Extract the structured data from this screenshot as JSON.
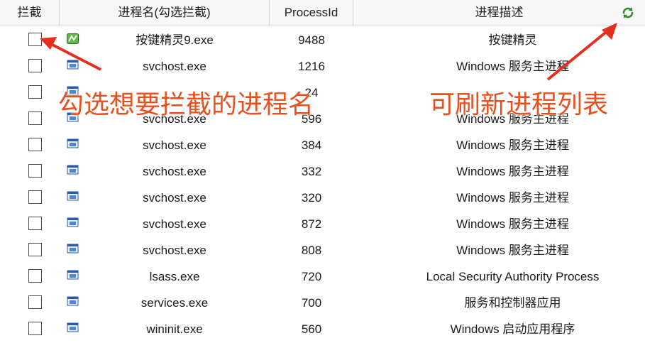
{
  "header": {
    "col_block": "拦截",
    "col_name": "进程名(勾选拦截)",
    "col_pid": "ProcessId",
    "col_desc": "进程描述",
    "refresh_icon": "refresh-icon"
  },
  "rows": [
    {
      "name": "按键精灵9.exe",
      "pid": "9488",
      "desc": "按键精灵",
      "icon": "app-green-icon"
    },
    {
      "name": "svchost.exe",
      "pid": "1216",
      "desc": "Windows 服务主进程",
      "icon": "window-icon"
    },
    {
      "name": "",
      "pid": "24",
      "desc": "",
      "icon": "window-icon"
    },
    {
      "name": "svchost.exe",
      "pid": "596",
      "desc": "Windows 服务主进程",
      "icon": "window-icon"
    },
    {
      "name": "svchost.exe",
      "pid": "384",
      "desc": "Windows 服务主进程",
      "icon": "window-icon"
    },
    {
      "name": "svchost.exe",
      "pid": "332",
      "desc": "Windows 服务主进程",
      "icon": "window-icon"
    },
    {
      "name": "svchost.exe",
      "pid": "320",
      "desc": "Windows 服务主进程",
      "icon": "window-icon"
    },
    {
      "name": "svchost.exe",
      "pid": "872",
      "desc": "Windows 服务主进程",
      "icon": "window-icon"
    },
    {
      "name": "svchost.exe",
      "pid": "808",
      "desc": "Windows 服务主进程",
      "icon": "window-icon"
    },
    {
      "name": "lsass.exe",
      "pid": "720",
      "desc": "Local Security Authority Process",
      "icon": "window-icon"
    },
    {
      "name": "services.exe",
      "pid": "700",
      "desc": "服务和控制器应用",
      "icon": "window-icon"
    },
    {
      "name": "wininit.exe",
      "pid": "560",
      "desc": "Windows 启动应用程序",
      "icon": "window-icon"
    }
  ],
  "annotations": {
    "left": "勾选想要拦截的进程名",
    "right": "可刷新进程列表",
    "color": "#e8501e"
  }
}
